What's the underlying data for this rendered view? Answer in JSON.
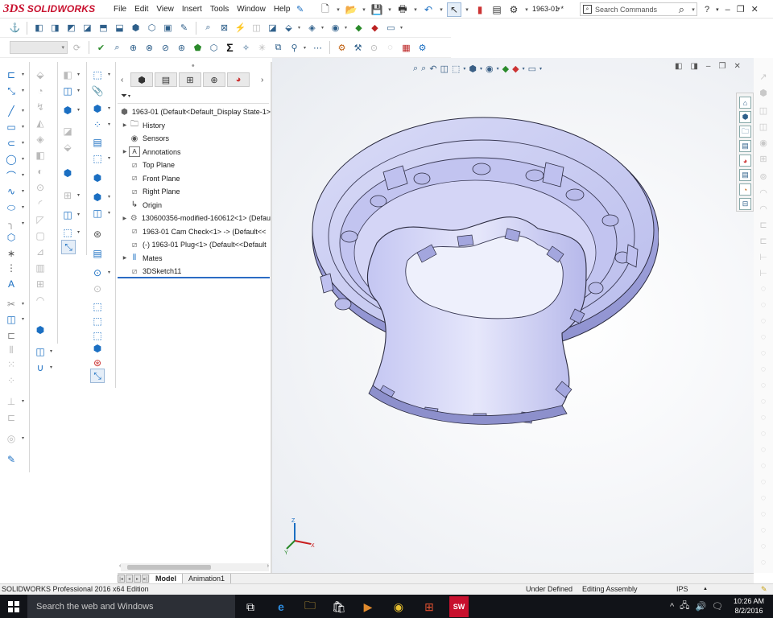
{
  "app": {
    "brand_prefix": "3DS",
    "brand": "SOLIDWORKS",
    "document_name": "1963-01 *"
  },
  "menu": {
    "items": [
      "File",
      "Edit",
      "View",
      "Insert",
      "Tools",
      "Window",
      "Help"
    ]
  },
  "search": {
    "placeholder": "Search Commands"
  },
  "window_controls": [
    "?",
    "–",
    "❐",
    "✕"
  ],
  "feature_manager": {
    "root": "1963-01  (Default<Default_Display State-1>",
    "items": [
      {
        "label": "History",
        "icon": "history-icon",
        "expand": true
      },
      {
        "label": "Sensors",
        "icon": "sensor-icon",
        "expand": false
      },
      {
        "label": "Annotations",
        "icon": "annotations-icon",
        "expand": true
      },
      {
        "label": "Top Plane",
        "icon": "plane-icon",
        "expand": false
      },
      {
        "label": "Front Plane",
        "icon": "plane-icon",
        "expand": false
      },
      {
        "label": "Right Plane",
        "icon": "plane-icon",
        "expand": false
      },
      {
        "label": "Origin",
        "icon": "origin-icon",
        "expand": false
      },
      {
        "label": "130600356-modified-160612<1> (Defau",
        "icon": "part-icon",
        "expand": true
      },
      {
        "label": "1963-01 Cam Check<1> -> (Default<<",
        "icon": "part-icon",
        "expand": false
      },
      {
        "label": "(-) 1963-01 Plug<1> (Default<<Default",
        "icon": "part-icon",
        "expand": false
      },
      {
        "label": "Mates",
        "icon": "mates-icon",
        "expand": true
      },
      {
        "label": "3DSketch11",
        "icon": "sketch-3d-icon",
        "expand": false
      }
    ]
  },
  "triad": {
    "x": "X",
    "y": "Y",
    "z": "Z"
  },
  "bottom_tabs": [
    "Model",
    "Animation1"
  ],
  "status_bar": {
    "product": "SOLIDWORKS Professional 2016 x64 Edition",
    "definition": "Under Defined",
    "mode": "Editing Assembly",
    "units": "IPS"
  },
  "taskbar": {
    "search_placeholder": "Search the web and Windows",
    "time": "10:26 AM",
    "date": "8/2/2016",
    "sw_badge": "SW"
  },
  "colors": {
    "brand_red": "#c8102e",
    "part_face": "#c9cbf2",
    "selection_blue": "#2b6cc4",
    "taskbar": "#111318"
  }
}
